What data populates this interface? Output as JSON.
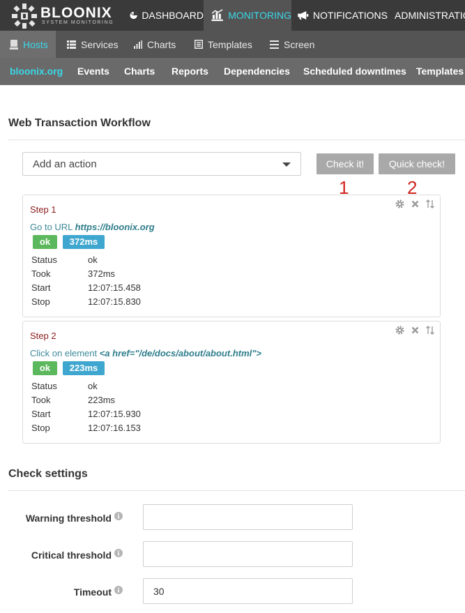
{
  "brand": {
    "name": "BLOONIX",
    "tagline": "SYSTEM MONITORING"
  },
  "top_nav": [
    {
      "label": "DASHBOARD",
      "icon": "dashboard-gauge-icon"
    },
    {
      "label": "MONITORING",
      "icon": "monitoring-chart-icon",
      "active": true
    },
    {
      "label": "NOTIFICATIONS",
      "icon": "megaphone-icon"
    },
    {
      "label": "ADMINISTRATION",
      "icon": "gears-icon"
    }
  ],
  "sub_nav": [
    {
      "label": "Hosts",
      "icon": "hosts-icon",
      "active": true
    },
    {
      "label": "Services",
      "icon": "list-icon"
    },
    {
      "label": "Charts",
      "icon": "bar-chart-icon"
    },
    {
      "label": "Templates",
      "icon": "template-icon"
    },
    {
      "label": "Screen",
      "icon": "screen-icon"
    }
  ],
  "host_nav": [
    "bloonix.org",
    "Events",
    "Charts",
    "Reports",
    "Dependencies",
    "Scheduled downtimes",
    "Templates"
  ],
  "workflow": {
    "title": "Web Transaction Workflow",
    "select_placeholder": "Add an action",
    "check_button": "Check it!",
    "quick_check_button": "Quick check!",
    "markers": [
      "1",
      "2"
    ],
    "steps": [
      {
        "title": "Step 1",
        "action_prefix": "Go to URL",
        "action_target": "https://bloonix.org",
        "status_badge": "ok",
        "time_badge": "372ms",
        "details": [
          {
            "key": "Status",
            "value": "ok"
          },
          {
            "key": "Took",
            "value": "372ms"
          },
          {
            "key": "Start",
            "value": "12:07:15.458"
          },
          {
            "key": "Stop",
            "value": "12:07:15.830"
          }
        ]
      },
      {
        "title": "Step 2",
        "action_prefix": "Click on element",
        "action_target": "<a href=\"/de/docs/about/about.html\">",
        "status_badge": "ok",
        "time_badge": "223ms",
        "details": [
          {
            "key": "Status",
            "value": "ok"
          },
          {
            "key": "Took",
            "value": "223ms"
          },
          {
            "key": "Start",
            "value": "12:07:15.930"
          },
          {
            "key": "Stop",
            "value": "12:07:16.153"
          }
        ]
      }
    ]
  },
  "settings": {
    "title": "Check settings",
    "fields": [
      {
        "label": "Warning threshold",
        "value": ""
      },
      {
        "label": "Critical threshold",
        "value": ""
      },
      {
        "label": "Timeout",
        "value": "30"
      }
    ]
  },
  "colors": {
    "accent": "#3ad8e8",
    "ok": "#5cb85c",
    "time": "#3fa7cf",
    "marker": "#d0241f",
    "step_title": "#8b1a1a"
  }
}
